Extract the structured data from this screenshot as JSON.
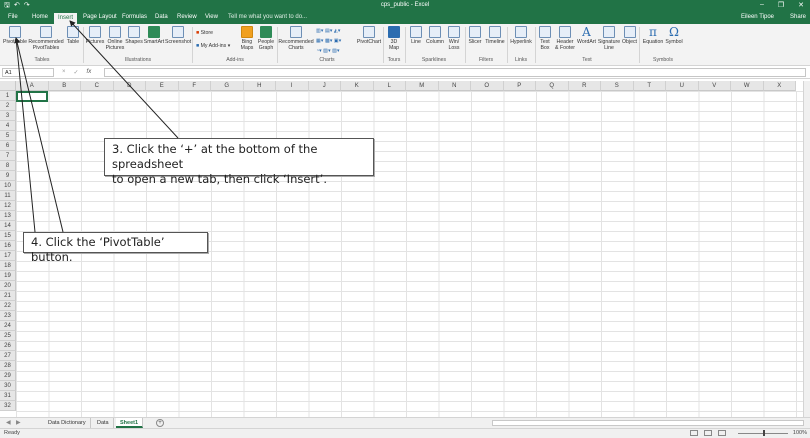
{
  "window": {
    "title": "cps_public - Excel"
  },
  "tabs": [
    "File",
    "Home",
    "Insert",
    "Page Layout",
    "Formulas",
    "Data",
    "Review",
    "View"
  ],
  "active_tab": "Insert",
  "tell_me": "Tell me what you want to do...",
  "user": "Eileen Tipoe",
  "share": "Share",
  "ribbon": {
    "pivottable": "PivotTable",
    "recommended_pivottables_1": "Recommended",
    "recommended_pivottables_2": "PivotTables",
    "table": "Table",
    "pictures": "Pictures",
    "online_pictures_1": "Online",
    "online_pictures_2": "Pictures",
    "shapes": "Shapes",
    "smartart": "SmartArt",
    "screenshot": "Screenshot",
    "store": "Store",
    "my_addins": "My Add-ins",
    "bing_maps_1": "Bing",
    "bing_maps_2": "Maps",
    "people_graph_1": "People",
    "people_graph_2": "Graph",
    "recommended_charts_1": "Recommended",
    "recommended_charts_2": "Charts",
    "pivotchart": "PivotChart",
    "map3d_1": "3D",
    "map3d_2": "Map",
    "line": "Line",
    "column": "Column",
    "winloss_1": "Win/",
    "winloss_2": "Loss",
    "slicer": "Slicer",
    "timeline": "Timeline",
    "hyperlink": "Hyperlink",
    "textbox_1": "Text",
    "textbox_2": "Box",
    "header_footer_1": "Header",
    "header_footer_2": "& Footer",
    "wordart": "WordArt",
    "signature_line_1": "Signature",
    "signature_line_2": "Line",
    "object": "Object",
    "equation": "Equation",
    "symbol": "Symbol",
    "equation_glyph": "π",
    "symbol_glyph": "Ω",
    "groups": {
      "tables": "Tables",
      "illustrations": "Illustrations",
      "addins": "Add-ins",
      "charts": "Charts",
      "tours": "Tours",
      "sparklines": "Sparklines",
      "filters": "Filters",
      "links": "Links",
      "text": "Text",
      "symbols": "Symbols"
    }
  },
  "formula_bar": {
    "name_box": "A1",
    "fx": "fx",
    "cancel": "×",
    "enter": "✓"
  },
  "grid": {
    "columns": [
      "A",
      "B",
      "C",
      "D",
      "E",
      "F",
      "G",
      "H",
      "I",
      "J",
      "K",
      "L",
      "M",
      "N",
      "O",
      "P",
      "Q",
      "R",
      "S",
      "T",
      "U",
      "V",
      "W",
      "X"
    ],
    "rows": [
      "1",
      "2",
      "3",
      "4",
      "5",
      "6",
      "7",
      "8",
      "9",
      "10",
      "11",
      "12",
      "13",
      "14",
      "15",
      "16",
      "17",
      "18",
      "19",
      "20",
      "21",
      "22",
      "23",
      "24",
      "25",
      "26",
      "27",
      "28",
      "29",
      "30",
      "31",
      "32"
    ]
  },
  "sheets": [
    "Data Dictionary",
    "Data",
    "Sheet1"
  ],
  "active_sheet": "Sheet1",
  "status": {
    "ready": "Ready",
    "zoom": "100%"
  },
  "callouts": {
    "step3_line1": "3. Click the ‘+’ at the bottom of the spreadsheet",
    "step3_line2": "to open a new tab, then click ‘Insert’.",
    "step4": "4. Click the ‘PivotTable’ button."
  }
}
